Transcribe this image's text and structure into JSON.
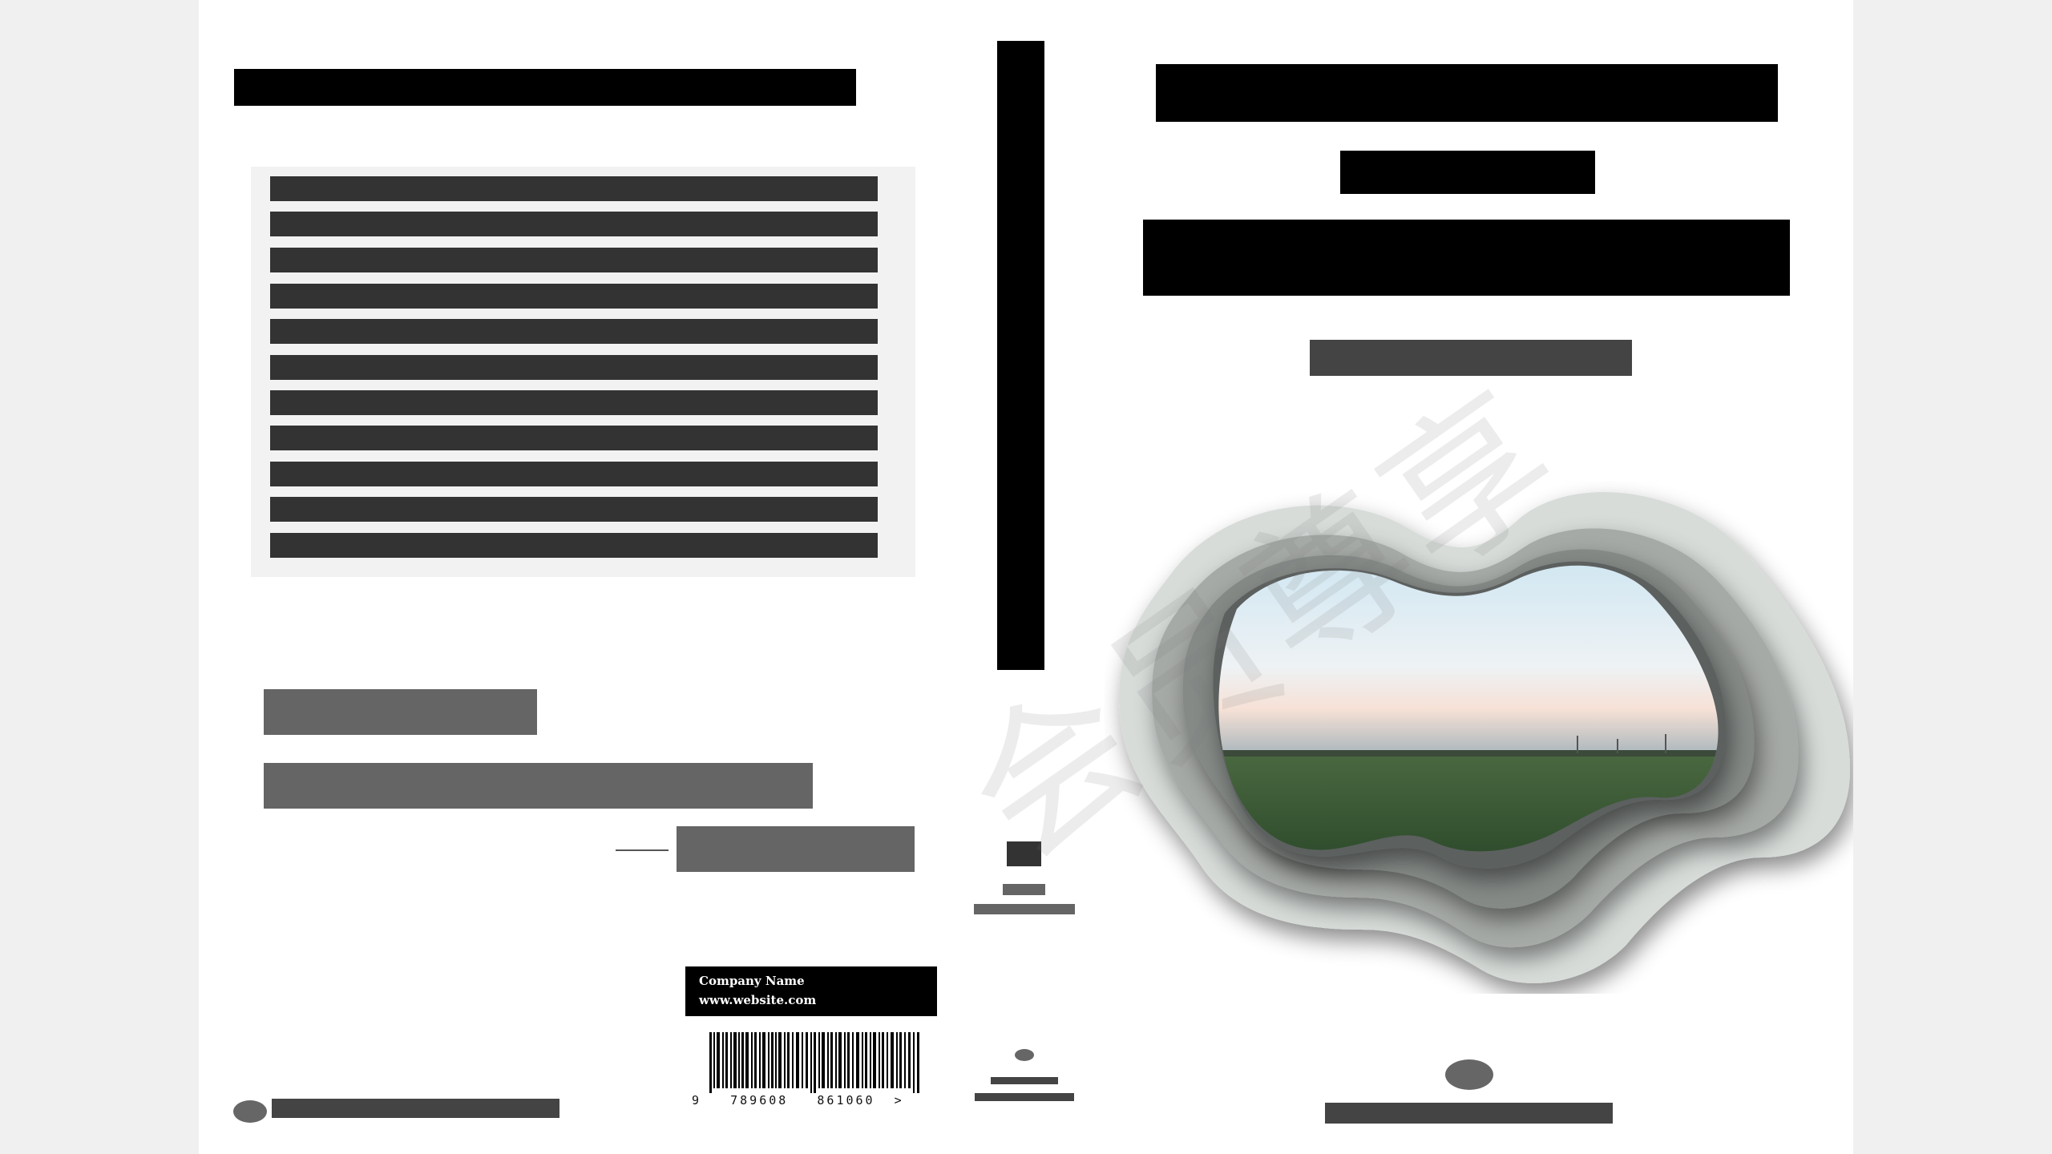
{
  "barcode": {
    "company_name": "Company Name",
    "website": "www.website.com",
    "digits": "9   789608   861060  >"
  },
  "watermark": {
    "text": "会员尊享"
  },
  "colors": {
    "sheet": "#ffffff",
    "background": "#f0f0f0",
    "placeholder_dark": "#333333",
    "placeholder_gray": "#656565",
    "black": "#000000"
  },
  "cover_art": {
    "icon": "field-landscape-cutout"
  }
}
